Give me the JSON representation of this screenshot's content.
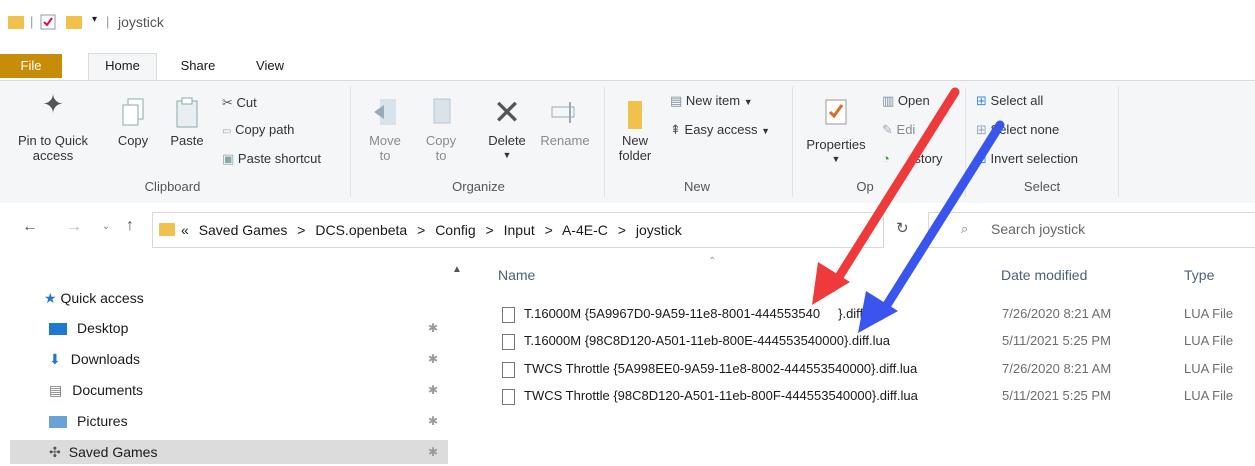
{
  "window": {
    "title": "joystick"
  },
  "ribbon_tabs": [
    "File",
    "Home",
    "Share",
    "View"
  ],
  "clipboard": {
    "pin_label": "Pin to Quick access",
    "copy_label": "Copy",
    "paste_label": "Paste",
    "cut_label": "Cut",
    "copy_path_label": "Copy path",
    "paste_shortcut_label": "Paste shortcut",
    "group_label": "Clipboard"
  },
  "organize": {
    "move_to_label": "Move to",
    "copy_to_label": "Copy to",
    "delete_label": "Delete",
    "rename_label": "Rename",
    "group_label": "Organize"
  },
  "new_group": {
    "new_folder_label": "New folder",
    "new_item_label": "New item",
    "easy_access_label": "Easy access",
    "group_label": "New"
  },
  "open_group": {
    "properties_label": "Properties",
    "open_label": "Open",
    "edit_label": "Edi",
    "history_label": "istory",
    "group_label": "Op"
  },
  "select_group": {
    "select_all_label": "Select all",
    "select_none_label": "Select none",
    "invert_selection_label": "Invert selection",
    "group_label": "Select"
  },
  "address": {
    "crumbs": [
      "«",
      "Saved Games",
      ">",
      "DCS.openbeta",
      ">",
      "Config",
      ">",
      "Input",
      ">",
      "A-4E-C",
      ">",
      "joystick"
    ]
  },
  "search": {
    "placeholder": "Search joystick"
  },
  "nav": {
    "quick_access": "Quick access",
    "items": [
      "Desktop",
      "Downloads",
      "Documents",
      "Pictures",
      "Saved Games"
    ]
  },
  "columns": {
    "name": "Name",
    "date": "Date modified",
    "type": "Type"
  },
  "files": [
    {
      "name": "T.16000M {5A9967D0-9A59-11e8-8001-444553540",
      "name_tail": "}.diff.lua",
      "date": "7/26/2020 8:21 AM",
      "type": "LUA File"
    },
    {
      "name": "T.16000M {98C8D120-A501-11eb-800E-444553540000}.diff.lua",
      "date": "5/11/2021 5:25 PM",
      "type": "LUA File"
    },
    {
      "name": "TWCS Throttle {5A998EE0-9A59-11e8-8002-444553540000}.diff.lua",
      "date": "7/26/2020 8:21 AM",
      "type": "LUA File"
    },
    {
      "name": "TWCS Throttle {98C8D120-A501-11eb-800F-444553540000}.diff.lua",
      "date": "5/11/2021 5:25 PM",
      "type": "LUA File"
    }
  ],
  "colors": {
    "file_tab": "#c78c08",
    "red_arrow": "#ee3a3a",
    "blue_arrow": "#3a55ee"
  }
}
